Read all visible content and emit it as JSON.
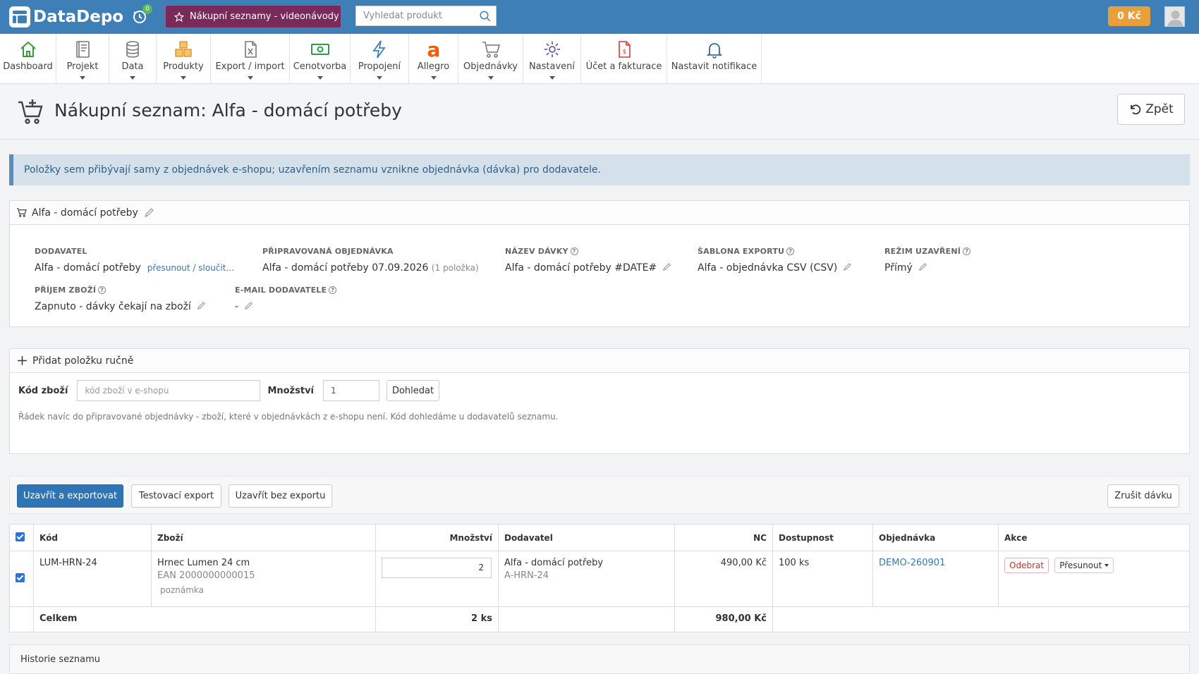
{
  "topbar": {
    "logo": "DataDepo",
    "history_badge": "0",
    "promo_label": "Nákupní seznamy - videonávody",
    "search_placeholder": "Vyhledat produkt",
    "credit": "0 Kč",
    "colors": {
      "topbar": "#3d7fb6",
      "promo": "#7a2a5a",
      "credit": "#e8a13a"
    }
  },
  "nav": [
    {
      "label": "Dashboard",
      "icon": "home-icon"
    },
    {
      "label": "Projekt",
      "icon": "book-icon"
    },
    {
      "label": "Data",
      "icon": "database-icon"
    },
    {
      "label": "Produkty",
      "icon": "boxes-icon"
    },
    {
      "label": "Export / import",
      "icon": "excel-file-icon"
    },
    {
      "label": "Cenotvorba",
      "icon": "money-icon"
    },
    {
      "label": "Propojení",
      "icon": "lightning-icon"
    },
    {
      "label": "Allegro",
      "icon": "allegro-icon"
    },
    {
      "label": "Objednávky",
      "icon": "cart-icon"
    },
    {
      "label": "Nastavení",
      "icon": "gear-icon"
    },
    {
      "label": "Účet a fakturace",
      "icon": "invoice-icon"
    },
    {
      "label": "Nastavit notifikace",
      "icon": "bell-icon"
    }
  ],
  "page": {
    "title": "Nákupní seznam: Alfa - domácí potřeby",
    "back_label": "Zpět"
  },
  "alert": "Položky sem přibývají samy z objednávek e-shopu; uzavřením seznamu vznikne objednávka (dávka) pro dodavatele.",
  "info_panel": {
    "title": "Alfa - domácí potřeby",
    "supplier_label": "DODAVATEL",
    "supplier_value": "Alfa - domácí potřeby",
    "supplier_link": "přesunout / sloučit...",
    "order_label": "PŘIPRAVOVANÁ OBJEDNÁVKA",
    "order_value": "Alfa - domácí potřeby 07.09.2026",
    "order_count": "(1 položka)",
    "batch_label": "NÁZEV DÁVKY",
    "batch_value": "Alfa - domácí potřeby #DATE#",
    "template_label": "ŠABLONA EXPORTU",
    "template_value": "Alfa - objednávka CSV (CSV)",
    "mode_label": "REŽIM UZAVŘENÍ",
    "mode_value": "Přímý",
    "receipt_label": "PŘÍJEM ZBOŽÍ",
    "receipt_value": "Zapnuto - dávky čekají na zboží",
    "email_label": "E-MAIL DODAVATELE",
    "email_value": "-"
  },
  "add_panel": {
    "title": "Přidat položku ručně",
    "code_label": "Kód zboží",
    "code_placeholder": "kód zboží v e-shopu",
    "qty_label": "Množství",
    "qty_value": "1",
    "search_button": "Dohledat",
    "hint": "Řádek navíc do připravované objednávky - zboží, které v objednávkách z e-shopu není. Kód dohledáme u dodavatelů seznamu."
  },
  "actions": {
    "close_export": "Uzavřít a exportovat",
    "test_export": "Testovací export",
    "close_no_export": "Uzavřít bez exportu",
    "cancel_batch": "Zrušit dávku"
  },
  "table": {
    "headers": {
      "code": "Kód",
      "item": "Zboží",
      "qty": "Množství",
      "supplier": "Dodavatel",
      "nc": "NC",
      "availability": "Dostupnost",
      "order": "Objednávka",
      "actions": "Akce"
    },
    "rows": [
      {
        "code": "LUM-HRN-24",
        "name": "Hrnec Lumen 24 cm",
        "ean": "EAN 2000000000015",
        "note": "poznámka",
        "qty": "2",
        "supplier": "Alfa - domácí potřeby",
        "supplier_code": "A-HRN-24",
        "nc": "490,00 Kč",
        "availability": "100 ks",
        "order": "DEMO-260901",
        "remove": "Odebrat",
        "move": "Přesunout"
      }
    ],
    "total": {
      "label": "Celkem",
      "qty": "2 ks",
      "nc": "980,00 Kč"
    }
  },
  "history_title": "Historie seznamu"
}
